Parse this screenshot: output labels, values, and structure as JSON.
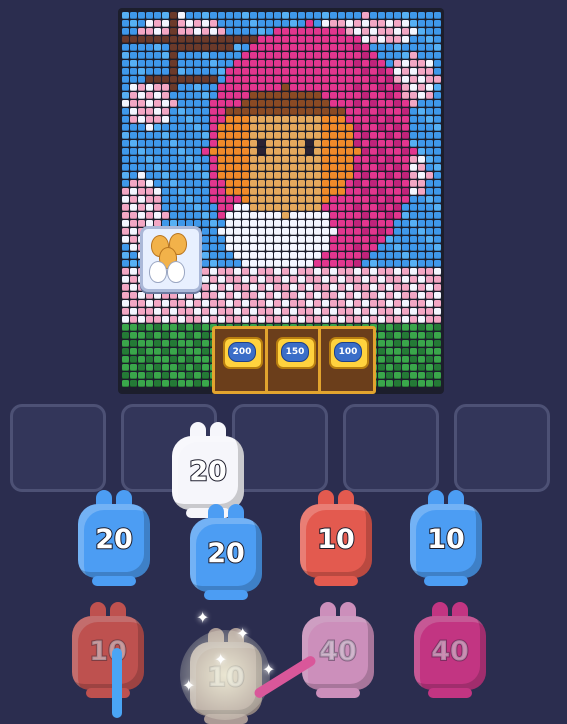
{
  "board": {
    "reward_gates": [
      {
        "label": "200"
      },
      {
        "label": "150"
      },
      {
        "label": "100"
      }
    ],
    "palette": {
      "sky": "#3f98ea",
      "sky2": "#56b0f4",
      "white": "#f4f6ff",
      "pink": "#f3a7c4",
      "hotpink": "#e2368e",
      "magenta": "#c1237a",
      "brown": "#8a4a24",
      "tan": "#e4a85d",
      "orange": "#f08a2a",
      "dark": "#2a2233",
      "green": "#3aa64b",
      "darkgreen": "#247a36",
      "branch": "#6b3a2a",
      "red": "#e0503a"
    }
  },
  "slots": [
    {
      "id": 1
    },
    {
      "id": 2
    },
    {
      "id": 3
    },
    {
      "id": 4
    },
    {
      "id": 5
    }
  ],
  "bunnies": [
    {
      "value": "20",
      "color": "#f6f6fb",
      "faded": false
    },
    {
      "value": "20",
      "color": "#4c9df3",
      "faded": false
    },
    {
      "value": "20",
      "color": "#4c9df3",
      "faded": false
    },
    {
      "value": "10",
      "color": "#e35a4f",
      "faded": false
    },
    {
      "value": "10",
      "color": "#4c9df3",
      "faded": false
    },
    {
      "value": "10",
      "color": "#e35a4f",
      "faded": true
    },
    {
      "value": "10",
      "color": "#cbb7a8",
      "faded": true
    },
    {
      "value": "40",
      "color": "#f5a8d6",
      "faded": true
    },
    {
      "value": "40",
      "color": "#e8388f",
      "faded": true
    }
  ]
}
